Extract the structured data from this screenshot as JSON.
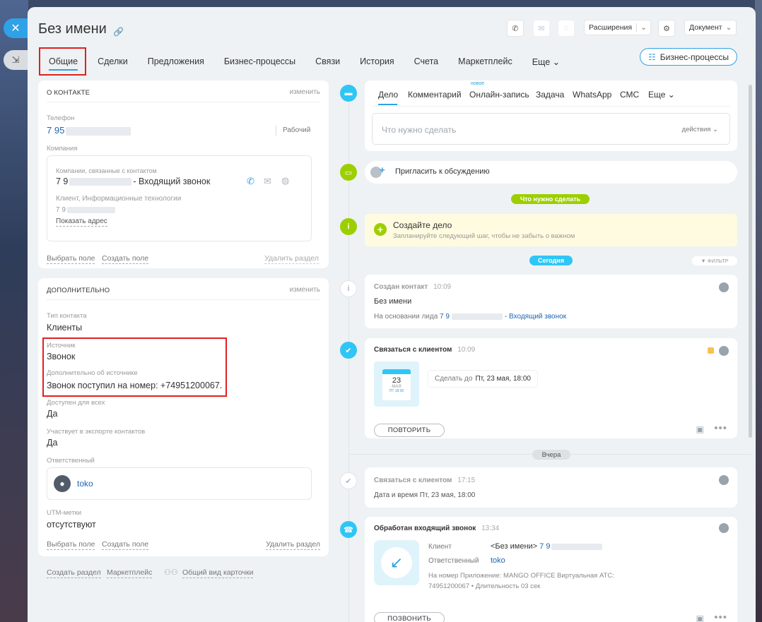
{
  "window": {
    "close_label": "✕",
    "collapse_label": "⇲"
  },
  "header": {
    "title": "Без имени",
    "extensions_label": "Расширения",
    "document_label": "Документ",
    "bp_button_label": "Бизнес-процессы"
  },
  "tabs": [
    {
      "label": "Общие"
    },
    {
      "label": "Сделки"
    },
    {
      "label": "Предложения"
    },
    {
      "label": "Бизнес-процессы"
    },
    {
      "label": "Связи"
    },
    {
      "label": "История"
    },
    {
      "label": "Счета"
    },
    {
      "label": "Маркетплейс"
    },
    {
      "label": "Еще"
    }
  ],
  "about": {
    "title": "О КОНТАКТЕ",
    "edit": "изменить",
    "phone_label": "Телефон",
    "phone_value": "7 95",
    "phone_type": "Рабочий",
    "company_label": "Компания",
    "linked_label": "Компании, связанные с контактом",
    "linked_name": "7 9 · Входящий звонок",
    "linked_name_visible": "- Входящий звонок",
    "client_line": "Клиент, Информационные технологии",
    "client_phone": "7 9",
    "show_address": "Показать адрес",
    "choose_field": "Выбрать поле",
    "create_field": "Создать поле",
    "delete_section": "Удалить раздел"
  },
  "extra": {
    "title": "ДОПОЛНИТЕЛЬНО",
    "edit": "изменить",
    "contact_type_label": "Тип контакта",
    "contact_type_value": "Клиенты",
    "source_label": "Источник",
    "source_value": "Звонок",
    "source_extra_label": "Дополнительно об источнике",
    "source_extra_value": "Звонок поступил на номер: +74951200067.",
    "available_label": "Доступен для всех",
    "available_value": "Да",
    "export_label": "Участвует в экспорте контактов",
    "export_value": "Да",
    "responsible_label": "Ответственный",
    "responsible_value": "toko",
    "utm_label": "UTM-метки",
    "utm_value": "отсутствуют",
    "choose_field": "Выбрать поле",
    "create_field": "Создать поле",
    "delete_section": "Удалить раздел"
  },
  "footer_links": {
    "create_section": "Создать раздел",
    "marketplace": "Маркетплейс",
    "common_view": "Общий вид карточки"
  },
  "composer": {
    "tabs": [
      "Дело",
      "Комментарий",
      "Онлайн-запись",
      "Задача",
      "WhatsApp",
      "СМС",
      "Еще"
    ],
    "new_badge": "новое",
    "placeholder": "Что нужно сделать",
    "actions_label": "действия"
  },
  "invite": {
    "label": "Пригласить к обсуждению"
  },
  "todo_pill": "Что нужно сделать",
  "create_task": {
    "title": "Создайте дело",
    "subtitle": "Запланируйте следующий шаг, чтобы не забыть о важном"
  },
  "today_pill": "Сегодня",
  "filter_label": "ФИЛЬТР",
  "created": {
    "title": "Создан контакт",
    "time": "10:09",
    "name": "Без имени",
    "based_on": "На основании лида",
    "lead_link": "7 9",
    "lead_suffix": "- Входящий звонок"
  },
  "contact_task": {
    "title": "Связаться с клиентом",
    "time": "10:09",
    "cal_day": "23",
    "cal_month": "МАЯ",
    "cal_weekday": "ПТ 18:00",
    "deadline_label": "Сделать до",
    "deadline_value": "Пт, 23 мая, 18:00",
    "repeat_button": "ПОВТОРИТЬ"
  },
  "yesterday_pill": "Вчера",
  "contact_task_done": {
    "title": "Связаться с клиентом",
    "time": "17:15",
    "datetime": "Дата и время Пт, 23 мая, 18:00"
  },
  "call": {
    "title": "Обработан входящий звонок",
    "time": "13:34",
    "client_label": "Клиент",
    "client_value": "<Без имени>",
    "client_phone": "7 9",
    "responsible_label": "Ответственный",
    "responsible_value": "toko",
    "number_line_1": "На номер Приложение: MANGO OFFICE Виртуальная АТС:",
    "number_line_2": "74951200067",
    "duration": "• Длительность 03 сек",
    "call_button": "ПОЗВОНИТЬ"
  },
  "colors": {
    "accent": "#2fa1e6",
    "green": "#9dcf00",
    "highlight": "#e02020",
    "link": "#2066b0"
  }
}
